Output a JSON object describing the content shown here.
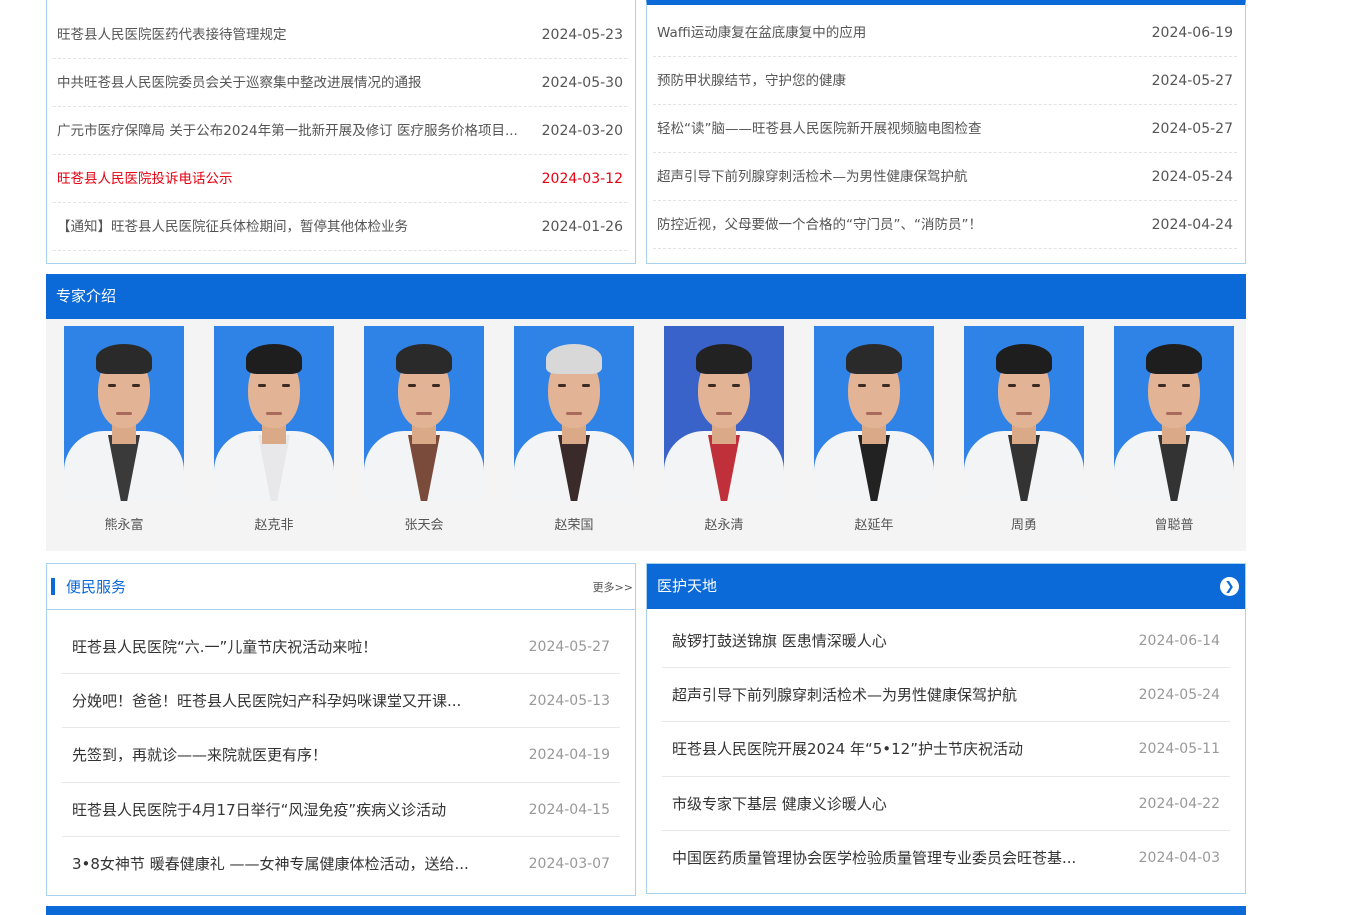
{
  "notices": [
    {
      "title": "旺苍县人民医院医药代表接待管理规定",
      "date": "2024-05-23",
      "highlight": false
    },
    {
      "title": "中共旺苍县人民医院委员会关于巡察集中整改进展情况的通报",
      "date": "2024-05-30",
      "highlight": false
    },
    {
      "title": "广元市医疗保障局 关于公布2024年第一批新开展及修订 医疗服务价格项目...",
      "date": "2024-03-20",
      "highlight": false
    },
    {
      "title": "旺苍县人民医院投诉电话公示",
      "date": "2024-03-12",
      "highlight": true
    },
    {
      "title": "【通知】旺苍县人民医院征兵体检期间，暂停其他体检业务",
      "date": "2024-01-26",
      "highlight": false
    }
  ],
  "health": [
    {
      "title": "Waffi运动康复在盆底康复中的应用",
      "date": "2024-06-19"
    },
    {
      "title": "预防甲状腺结节，守护您的健康",
      "date": "2024-05-27"
    },
    {
      "title": "轻松“读”脑——旺苍县人民医院新开展视频脑电图检查",
      "date": "2024-05-27"
    },
    {
      "title": "超声引导下前列腺穿刺活检术—为男性健康保驾护航",
      "date": "2024-05-24"
    },
    {
      "title": "防控近视，父母要做一个合格的“守门员”、“消防员”！",
      "date": "2024-04-24"
    }
  ],
  "experts": {
    "title": "专家介绍",
    "items": [
      {
        "name": "熊永富",
        "bg": "#2f82e6",
        "shirt": "#3a3a3a",
        "hair": "#2a2a2a"
      },
      {
        "name": "赵克非",
        "bg": "#2f82e6",
        "shirt": "#e8e8ea",
        "hair": "#1e1e1e"
      },
      {
        "name": "张天会",
        "bg": "#2f82e6",
        "shirt": "#7a4a3a",
        "hair": "#2a2a2a"
      },
      {
        "name": "赵荣国",
        "bg": "#2f82e6",
        "shirt": "#3a2a2a",
        "hair": "#d8d8d8"
      },
      {
        "name": "赵永清",
        "bg": "#3a63c9",
        "shirt": "#c0303a",
        "hair": "#222222"
      },
      {
        "name": "赵延年",
        "bg": "#2f82e6",
        "shirt": "#222222",
        "hair": "#2a2a2a"
      },
      {
        "name": "周勇",
        "bg": "#2f82e6",
        "shirt": "#333333",
        "hair": "#1e1e1e"
      },
      {
        "name": "曾聪普",
        "bg": "#2f82e6",
        "shirt": "#333333",
        "hair": "#1e1e1e"
      }
    ]
  },
  "service": {
    "title": "便民服务",
    "more": "更多>>",
    "items": [
      {
        "title": "旺苍县人民医院“六.一”儿童节庆祝活动来啦！",
        "date": "2024-05-27"
      },
      {
        "title": "分娩吧！爸爸！旺苍县人民医院妇产科孕妈咪课堂又开课...",
        "date": "2024-05-13"
      },
      {
        "title": "先签到，再就诊——来院就医更有序！",
        "date": "2024-04-19"
      },
      {
        "title": "旺苍县人民医院于4月17日举行“风湿免疫”疾病义诊活动",
        "date": "2024-04-15"
      },
      {
        "title": "3•8女神节 暖春健康礼 ——女神专属健康体检活动，送给...",
        "date": "2024-03-07"
      }
    ]
  },
  "care": {
    "title": "医护天地",
    "arrow_icon": "arrow-right-icon",
    "items": [
      {
        "title": "敲锣打鼓送锦旗 医患情深暖人心",
        "date": "2024-06-14"
      },
      {
        "title": "超声引导下前列腺穿刺活检术—为男性健康保驾护航",
        "date": "2024-05-24"
      },
      {
        "title": "旺苍县人民医院开展2024 年“5•12”护士节庆祝活动",
        "date": "2024-05-11"
      },
      {
        "title": "市级专家下基层 健康义诊暖人心",
        "date": "2024-04-22"
      },
      {
        "title": "中国医药质量管理协会医学检验质量管理专业委员会旺苍基...",
        "date": "2024-04-03"
      }
    ]
  },
  "colors": {
    "accent": "#0b6ad8",
    "highlight": "#e60012",
    "border": "#a9d2ee"
  }
}
